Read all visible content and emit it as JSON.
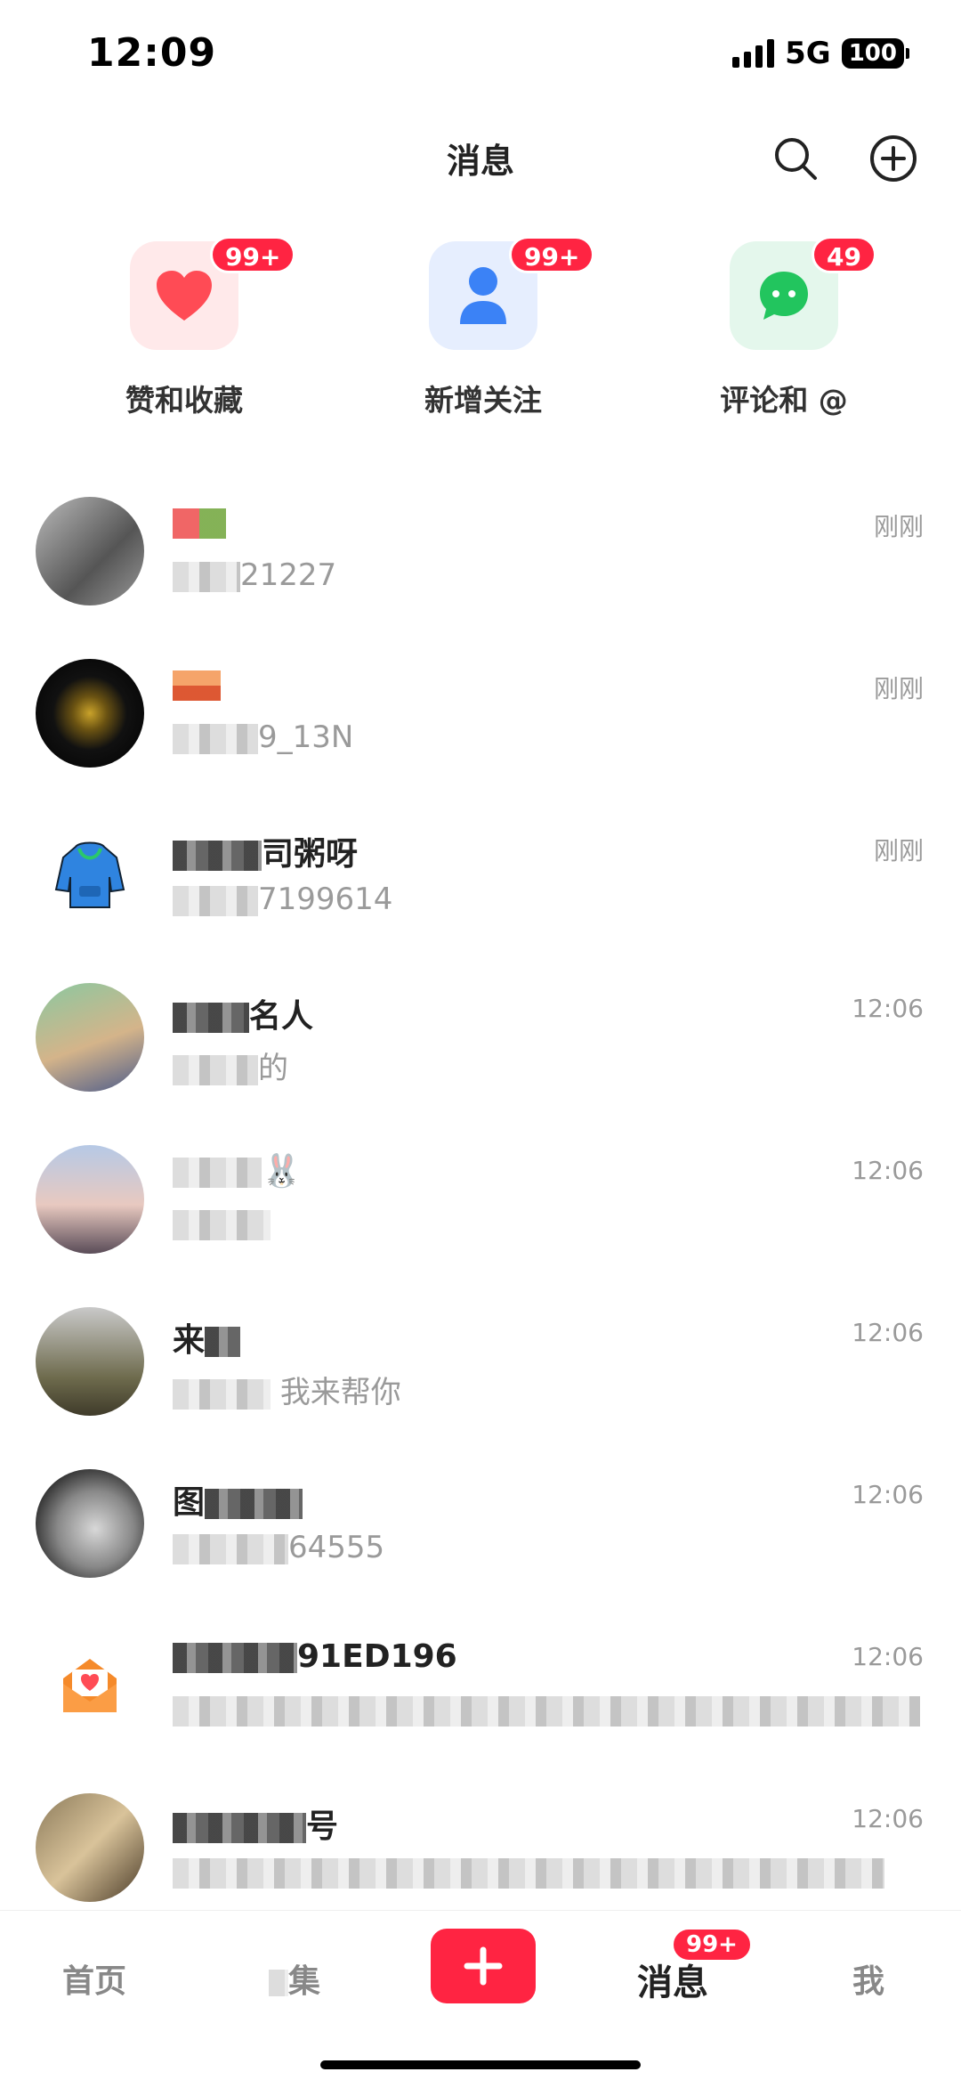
{
  "status_bar": {
    "time": "12:09",
    "network": "5G",
    "battery": "100"
  },
  "header": {
    "title": "消息",
    "search_icon": "search-icon",
    "add_icon": "plus-circle-icon"
  },
  "shortcuts": [
    {
      "label": "赞和收藏",
      "badge": "99+",
      "icon": "heart-icon",
      "color": "#ff4b55",
      "bg": "#ffe9ea"
    },
    {
      "label": "新增关注",
      "badge": "99+",
      "icon": "person-icon",
      "color": "#3b82f6",
      "bg": "#e6eefe"
    },
    {
      "label": "评论和 @",
      "badge": "49",
      "icon": "chat-bubble-icon",
      "color": "#22c55e",
      "bg": "#e4f7ec"
    }
  ],
  "messages": [
    {
      "name": "",
      "preview": "21227",
      "time": "刚刚"
    },
    {
      "name": "",
      "preview": "9_13N",
      "time": "刚刚"
    },
    {
      "name": "司粥呀",
      "preview": "7199614",
      "time": "刚刚"
    },
    {
      "name": "名人",
      "preview": "的",
      "time": "12:06"
    },
    {
      "name": "🐰",
      "preview": "",
      "time": "12:06"
    },
    {
      "name": "来",
      "preview": "我来帮你",
      "time": "12:06"
    },
    {
      "name": "图",
      "preview": "64555",
      "time": "12:06"
    },
    {
      "name": "91ED196",
      "preview": "",
      "time": "12:06"
    },
    {
      "name": "号",
      "preview": "",
      "time": "12:06"
    }
  ],
  "tab_bar": {
    "home": "首页",
    "market": "集",
    "messages": "消息",
    "messages_badge": "99+",
    "me": "我"
  },
  "colors": {
    "accent": "#ff2442"
  }
}
